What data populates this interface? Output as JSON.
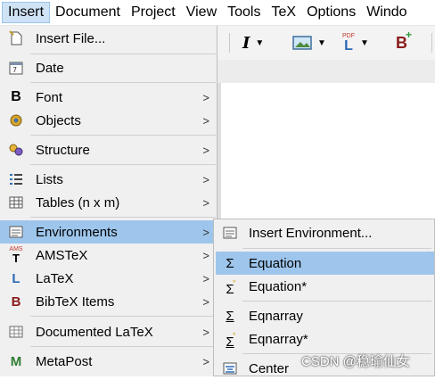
{
  "menubar": {
    "items": [
      "Insert",
      "Document",
      "Project",
      "View",
      "Tools",
      "TeX",
      "Options",
      "Windo"
    ]
  },
  "toolbar": {
    "italic": "I",
    "pdf_top": "PDF",
    "pdf_letter": "L",
    "bib_letter": "B",
    "plus": "+"
  },
  "menu": {
    "items": [
      {
        "label": "Insert File...",
        "icon": "insert-file-icon",
        "submenu": false
      },
      {
        "label": "Date",
        "icon": "date-icon",
        "submenu": false
      },
      {
        "label": "Font",
        "icon": "bold-font-icon",
        "icon_text": "B",
        "submenu": true
      },
      {
        "label": "Objects",
        "icon": "objects-icon",
        "submenu": true
      },
      {
        "label": "Structure",
        "icon": "structure-icon",
        "submenu": true
      },
      {
        "label": "Lists",
        "icon": "list-icon",
        "submenu": true
      },
      {
        "label": "Tables (n x m)",
        "icon": "table-icon",
        "submenu": true
      },
      {
        "label": "Environments",
        "icon": "environments-icon",
        "submenu": true,
        "highlighted": true
      },
      {
        "label": "AMSTeX",
        "icon": "amstex-icon",
        "icon_text": "AMS",
        "submenu": true
      },
      {
        "label": "LaTeX",
        "icon": "latex-icon",
        "icon_text": "L",
        "submenu": true
      },
      {
        "label": "BibTeX Items",
        "icon": "bibtex-icon",
        "icon_text": "B",
        "submenu": true
      },
      {
        "label": "Documented LaTeX",
        "icon": "documented-latex-icon",
        "submenu": true
      },
      {
        "label": "MetaPost",
        "icon": "metapost-icon",
        "icon_text": "M",
        "submenu": true
      }
    ],
    "arrow": ">"
  },
  "submenu": {
    "items": [
      {
        "label": "Insert Environment...",
        "icon": "insert-environment-icon"
      },
      {
        "label": "Equation",
        "icon": "sigma-icon",
        "icon_text": "Σ",
        "highlighted": true
      },
      {
        "label": "Equation*",
        "icon": "sigma-star-icon",
        "icon_text": "Σ"
      },
      {
        "label": "Eqnarray",
        "icon": "sigma-array-icon",
        "icon_text": "Σ"
      },
      {
        "label": "Eqnarray*",
        "icon": "sigma-array-star-icon",
        "icon_text": "Σ"
      },
      {
        "label": "Center",
        "icon": "center-align-icon"
      }
    ]
  },
  "watermark": "CSDN @稳瑜仙女",
  "colors": {
    "highlight": "#9ec6ec",
    "menu_bg": "#f0f0f0",
    "active_menubar": "#cfe3f6"
  }
}
